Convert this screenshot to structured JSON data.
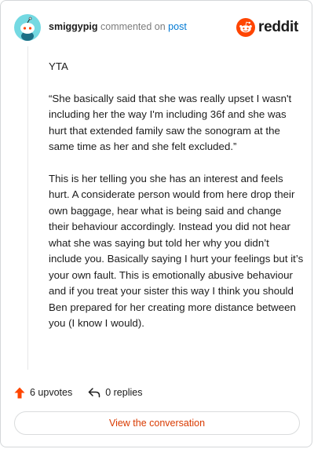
{
  "comment": {
    "username": "smiggypig",
    "action_text": "commented on",
    "target_link": "post",
    "paragraphs": [
      "YTA",
      "“She basically said that she was really upset I wasn't including her the way I'm including 36f and she was hurt that extended family saw the sonogram at the same time as her and she felt excluded.”",
      "This is her telling you she has an interest and feels hurt. A considerate person would from here drop their own baggage, hear what is being said and change their behaviour accordingly. Instead you did not hear what she was saying but told her why you didn’t include you. Basically saying I hurt your feelings but it’s your own fault. This is emotionally abusive behaviour and if you treat your sister this way I think you should Ben prepared for her creating more distance between you (I know I would)."
    ],
    "upvotes_label": "6 upvotes",
    "replies_label": "0 replies"
  },
  "brand": {
    "wordmark": "reddit",
    "logo_icon": "reddit-snoo-icon",
    "accent": "#ff4500"
  },
  "avatar": {
    "icon": "snoo-avatar-icon",
    "background": "#74d9e2"
  },
  "actions": {
    "upvote_icon": "upvote-arrow-icon",
    "upvote_color": "#ff4500",
    "reply_icon": "reply-arrow-icon"
  },
  "footer": {
    "button_label": "View the conversation",
    "button_color": "#d93a00"
  }
}
